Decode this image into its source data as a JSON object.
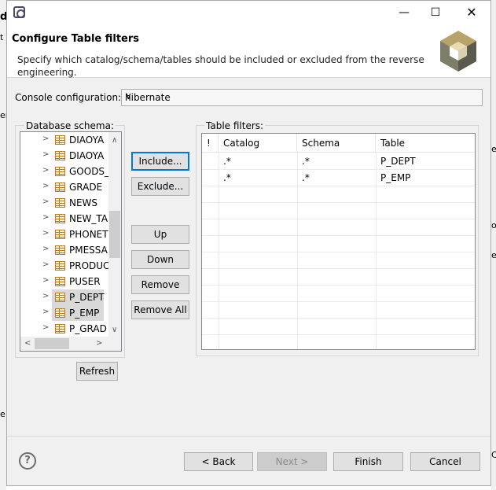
{
  "window": {
    "title": ""
  },
  "header": {
    "title": "Configure Table filters",
    "description": "Specify which catalog/schema/tables should be included or excluded from the reverse engineering."
  },
  "console": {
    "label": "Console configuration:",
    "value": "hibernate"
  },
  "schema": {
    "label": "Database schema:",
    "items": [
      {
        "name": "DIAOYA",
        "selected": false
      },
      {
        "name": "DIAOYA",
        "selected": false
      },
      {
        "name": "GOODS_",
        "selected": false
      },
      {
        "name": "GRADE",
        "selected": false
      },
      {
        "name": "NEWS",
        "selected": false
      },
      {
        "name": "NEW_TA",
        "selected": false
      },
      {
        "name": "PHONET",
        "selected": false
      },
      {
        "name": "PMESSA",
        "selected": false
      },
      {
        "name": "PRODUC",
        "selected": false
      },
      {
        "name": "PUSER",
        "selected": false
      },
      {
        "name": "P_DEPT",
        "selected": true
      },
      {
        "name": "P_EMP",
        "selected": true
      },
      {
        "name": "P_GRAD",
        "selected": false
      }
    ]
  },
  "buttons": {
    "include": "Include...",
    "exclude": "Exclude...",
    "up": "Up",
    "down": "Down",
    "remove": "Remove",
    "remove_all": "Remove All",
    "refresh": "Refresh",
    "back": "< Back",
    "next": "Next >",
    "finish": "Finish",
    "cancel": "Cancel"
  },
  "filters": {
    "label": "Table filters:",
    "columns": [
      "!",
      "Catalog",
      "Schema",
      "Table"
    ],
    "rows": [
      {
        "flag": "",
        "catalog": ".*",
        "schema": ".*",
        "table": "P_DEPT"
      },
      {
        "flag": "",
        "catalog": ".*",
        "schema": ".*",
        "table": "P_EMP"
      }
    ]
  },
  "background": {
    "left_top": "d",
    "left_mid": "t",
    "left_low": "er",
    "right_a": "e",
    "right_b": "o.",
    "right_c": "e",
    "bottom_left": "e",
    "bottom_right": "C"
  },
  "colors": {
    "accent": "#0078d7",
    "dialog_bg": "#f0f0f0",
    "selection": "#d9d9d9"
  },
  "icons": {
    "help": "?"
  }
}
